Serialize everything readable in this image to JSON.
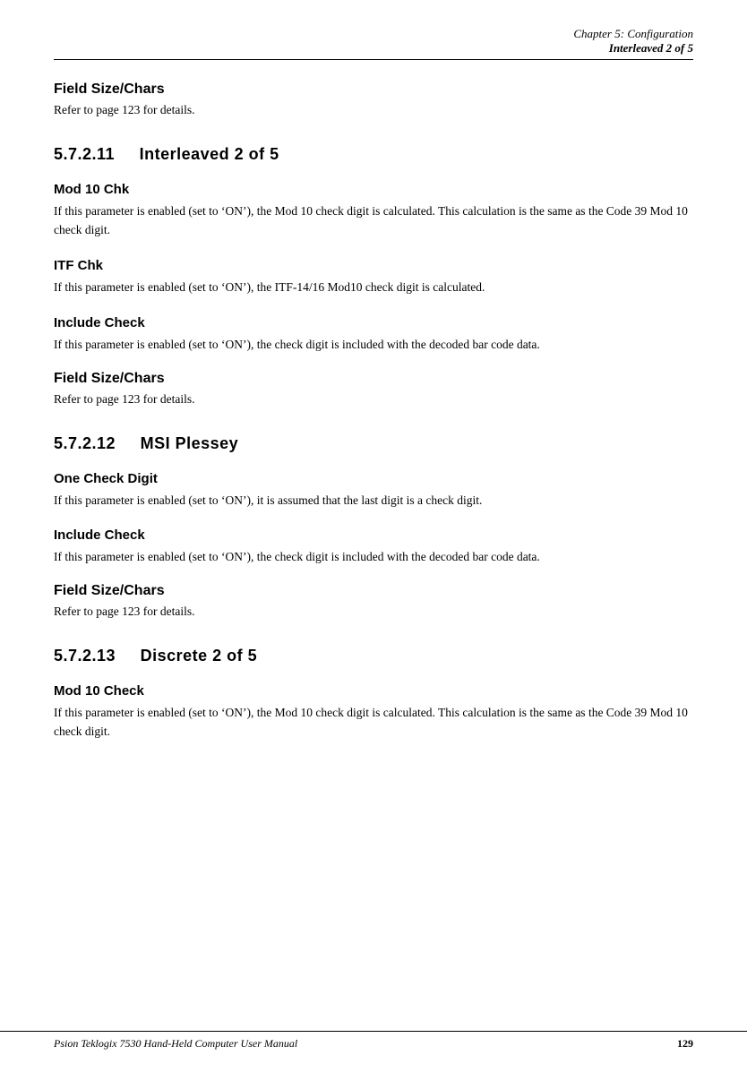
{
  "header": {
    "line1": "Chapter  5:  Configuration",
    "line2": "Interleaved 2 of 5"
  },
  "sections": [
    {
      "id": "field-size-chars-1",
      "heading": "Field  Size/Chars",
      "body": "Refer to page 123 for details."
    },
    {
      "id": "section-5-7-2-11",
      "number": "5.7.2.11",
      "title": "Interleaved  2  of  5",
      "subsections": [
        {
          "id": "mod-10-chk",
          "heading": "Mod  10  Chk",
          "body": "If this parameter is enabled (set to ‘ON’), the Mod 10 check digit is calculated. This calculation is the same as the Code 39 Mod 10 check digit."
        },
        {
          "id": "itf-chk",
          "heading": "ITF  Chk",
          "body": "If this parameter is enabled (set to ‘ON’), the ITF-14/16 Mod10 check digit is calculated."
        },
        {
          "id": "include-check-1",
          "heading": "Include  Check",
          "body": "If this parameter is enabled (set to ‘ON’), the check digit is included with the decoded bar code data."
        },
        {
          "id": "field-size-chars-2",
          "heading": "Field  Size/Chars",
          "body": "Refer to page 123 for details."
        }
      ]
    },
    {
      "id": "section-5-7-2-12",
      "number": "5.7.2.12",
      "title": "MSI  Plessey",
      "subsections": [
        {
          "id": "one-check-digit",
          "heading": "One  Check  Digit",
          "body": "If this parameter is enabled (set to ‘ON’), it is assumed that the last digit is a check digit."
        },
        {
          "id": "include-check-2",
          "heading": "Include  Check",
          "body": "If this parameter is enabled (set to ‘ON’), the check digit is included with the decoded bar code data."
        },
        {
          "id": "field-size-chars-3",
          "heading": "Field  Size/Chars",
          "body": "Refer to page 123 for details."
        }
      ]
    },
    {
      "id": "section-5-7-2-13",
      "number": "5.7.2.13",
      "title": "Discrete  2  of  5",
      "subsections": [
        {
          "id": "mod-10-check",
          "heading": "Mod  10  Check",
          "body": "If this parameter is enabled (set to ‘ON’), the Mod 10 check digit is calculated. This calculation is the same as the Code 39 Mod 10 check digit."
        }
      ]
    }
  ],
  "footer": {
    "left": "Psion Teklogix 7530 Hand-Held Computer User Manual",
    "right": "129"
  }
}
